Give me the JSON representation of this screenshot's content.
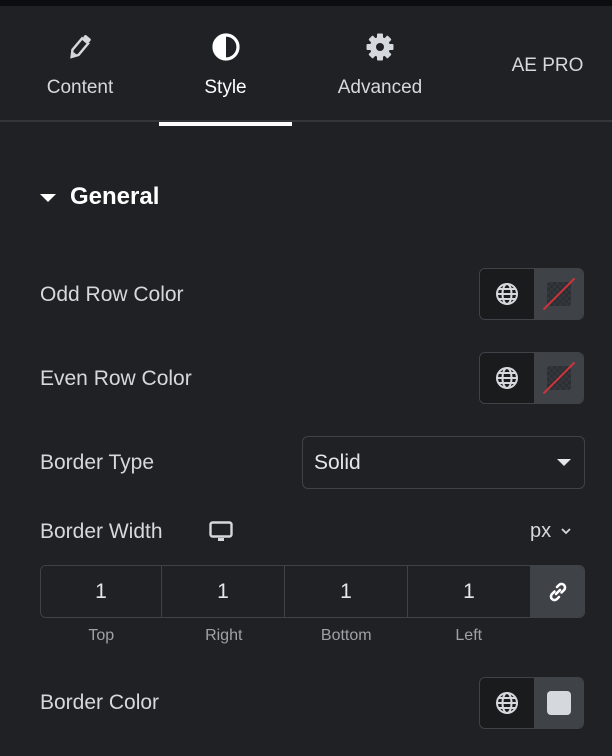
{
  "tabs": [
    {
      "label": "Content",
      "icon": "pencil-icon",
      "active": false
    },
    {
      "label": "Style",
      "icon": "contrast-icon",
      "active": true
    },
    {
      "label": "Advanced",
      "icon": "gear-icon",
      "active": false
    },
    {
      "label": "AE PRO",
      "icon": null,
      "active": false
    }
  ],
  "section": {
    "title": "General",
    "expanded": true
  },
  "controls": {
    "odd_row_color": {
      "label": "Odd Row Color",
      "value": "none"
    },
    "even_row_color": {
      "label": "Even Row Color",
      "value": "none"
    },
    "border_type": {
      "label": "Border Type",
      "value": "Solid"
    },
    "border_width": {
      "label": "Border Width",
      "device": "desktop-icon",
      "unit": "px",
      "values": {
        "top": "1",
        "right": "1",
        "bottom": "1",
        "left": "1"
      },
      "labels": {
        "top": "Top",
        "right": "Right",
        "bottom": "Bottom",
        "left": "Left"
      },
      "linked": true
    },
    "border_color": {
      "label": "Border Color",
      "value": "#d5d8dc"
    }
  },
  "colors": {
    "accent_underline": "#fcfdfc",
    "no_color_slash": "#d0333b"
  }
}
